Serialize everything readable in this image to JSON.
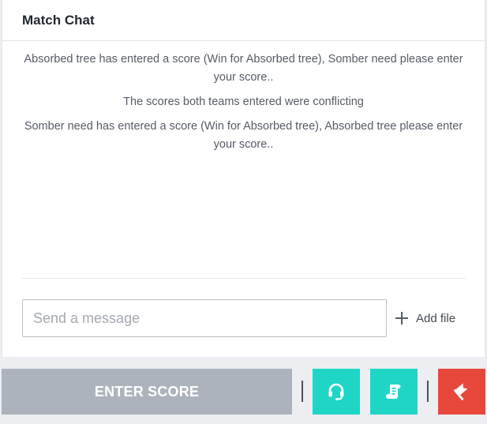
{
  "chat": {
    "title": "Match Chat",
    "messages": [
      "Absorbed tree has entered a score (Win for Absorbed tree), Somber need please enter your score..",
      "The scores both teams entered were conflicting",
      "Somber need has entered a score (Win for Absorbed tree), Absorbed tree please enter your score.."
    ],
    "input_placeholder": "Send a message",
    "add_file_label": "Add file"
  },
  "actions": {
    "enter_score_label": "ENTER SCORE",
    "support_icon": "headset-icon",
    "rules_icon": "scroll-icon",
    "dispute_icon": "flag-icon"
  },
  "colors": {
    "teal_button": "#1fd6c6",
    "red_button": "#e8473c",
    "enter_score_bg": "#adb3bd"
  }
}
